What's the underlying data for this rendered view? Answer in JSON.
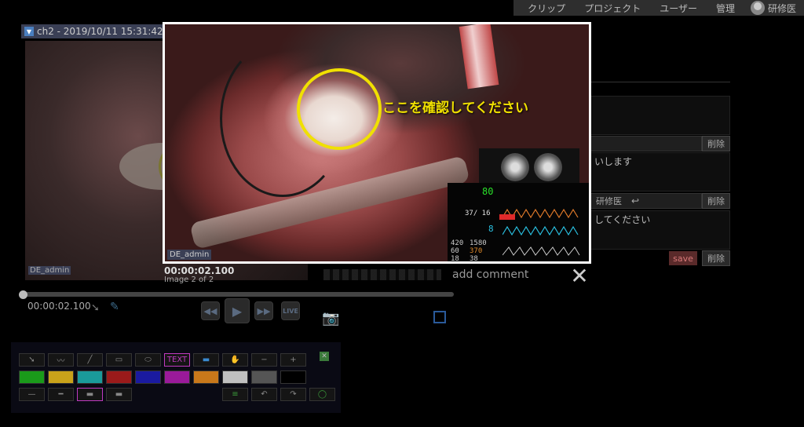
{
  "nav": {
    "items": [
      "クリップ",
      "プロジェクト",
      "ユーザー",
      "管理"
    ],
    "user": "研修医"
  },
  "player": {
    "channel_title": "ch2 - 2019/10/11 15:31:42",
    "time": "00:00:02.100",
    "video_badge": "DE_admin",
    "live_label": "LIVE"
  },
  "palette": {
    "text_label": "TEXT",
    "colors": [
      "#1a9a1a",
      "#c9a21a",
      "#1a9a9a",
      "#9a1a1a",
      "#1a1aa0",
      "#9a1a9a",
      "#c8781a",
      "#c0c0c0",
      "#555555",
      "#000000"
    ]
  },
  "comments": {
    "user_label": "研修医",
    "text1": "いします",
    "text2": "してください",
    "delete_label": "削除",
    "save_label": "save",
    "add_comment_placeholder": "add comment"
  },
  "modal": {
    "annotation_text": "ここを確認してください",
    "badge": "DE_admin",
    "timestamp": "00:00:02.100",
    "counter": "Image 2 of 2",
    "close_glyph": "✕"
  },
  "monitor": {
    "hr": "80",
    "bp": "37/ 16",
    "spo2": "8",
    "vals": [
      "420",
      "1580",
      "60",
      "370",
      "18",
      "38"
    ]
  },
  "colors": {
    "annotation": "#f0e000",
    "accent": "#2a5a9a",
    "save": "#d87878"
  }
}
